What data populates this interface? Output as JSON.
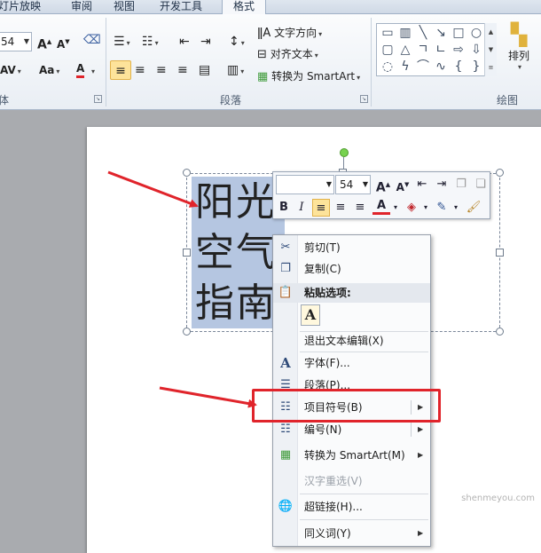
{
  "ribbon": {
    "tabs": [
      {
        "label": "灯片放映"
      },
      {
        "label": "审阅"
      },
      {
        "label": "视图"
      },
      {
        "label": "开发工具"
      },
      {
        "label": "格式",
        "active": true
      }
    ],
    "font_size_value": "54",
    "paragraph_group_label": "段落",
    "drawing_group_label": "绘图",
    "font_group_label_fragment": "体",
    "text_direction_label": "文字方向",
    "align_text_label": "对齐文本",
    "convert_smartart_label": "转换为 SmartArt",
    "arrange_label": "排列"
  },
  "textbox": {
    "lines": [
      "阳光",
      "空气",
      "指南"
    ]
  },
  "mini_toolbar": {
    "font_name_value": "",
    "font_size_value": "54"
  },
  "context_menu": {
    "items": [
      {
        "label": "剪切(T)",
        "icon": "scissors-icon"
      },
      {
        "label": "复制(C)",
        "icon": "copy-icon"
      },
      {
        "label": "粘贴选项:",
        "icon": "paste-icon"
      },
      {
        "label": "退出文本编辑(X)"
      },
      {
        "label": "字体(F)...",
        "icon": "font-icon"
      },
      {
        "label": "段落(P)...",
        "icon": "paragraph-icon"
      },
      {
        "label": "项目符号(B)",
        "icon": "bullets-icon",
        "submenu": true
      },
      {
        "label": "编号(N)",
        "icon": "numbering-icon",
        "submenu": true
      },
      {
        "label": "转换为 SmartArt(M)",
        "icon": "smartart-icon",
        "submenu": true
      },
      {
        "label": "汉字重选(V)",
        "disabled": true
      },
      {
        "label": "超链接(H)...",
        "icon": "hyperlink-icon"
      },
      {
        "label": "同义词(Y)",
        "submenu": true
      }
    ],
    "paste_keep_text_glyph": "A"
  },
  "watermark": "shenmeyou.com",
  "colors": {
    "highlight": "#e0242b",
    "selection": "#b5c6e1",
    "rotate_handle": "#77d24f",
    "ribbon_selected": "#fde39a"
  }
}
